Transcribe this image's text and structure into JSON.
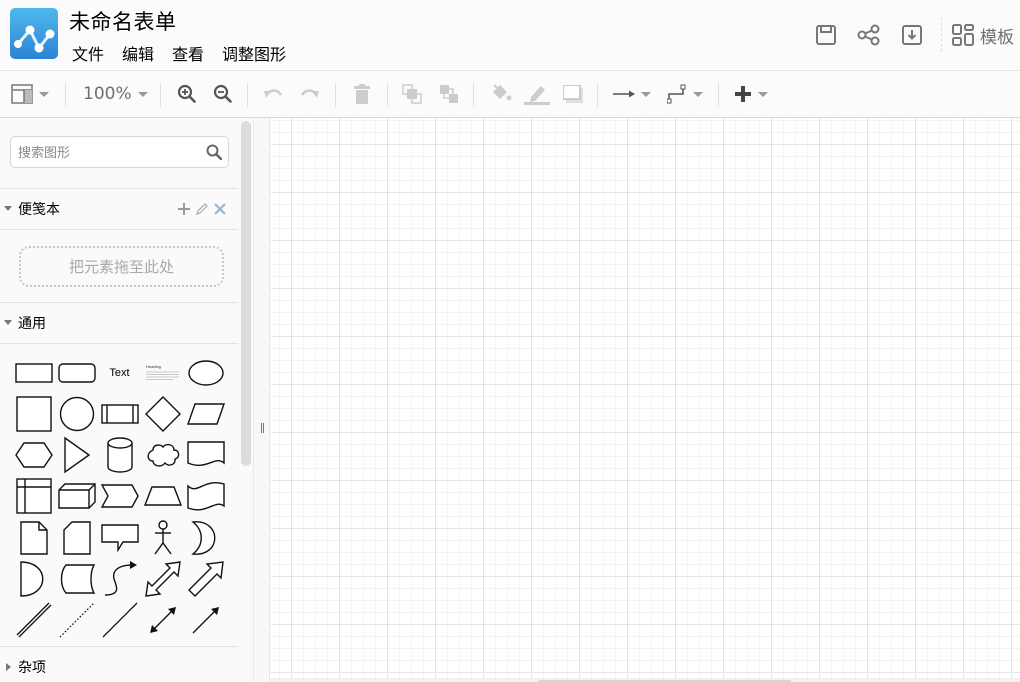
{
  "app": {
    "title": "未命名表单",
    "logo_icon": "diagram-graph-icon",
    "brand_color": "#3a9ce2"
  },
  "menu": [
    {
      "label": "文件"
    },
    {
      "label": "编辑"
    },
    {
      "label": "查看"
    },
    {
      "label": "调整图形"
    }
  ],
  "header_actions": {
    "save_icon": "save-icon",
    "share_icon": "share-icon",
    "download_icon": "download-icon",
    "templates_label": "模板",
    "templates_icon": "grid-icon"
  },
  "toolbar": {
    "zoom_level": "100%",
    "buttons": [
      {
        "name": "format-panel-toggle",
        "icon": "panel-layout-icon",
        "enabled": true
      },
      {
        "name": "zoom-in",
        "icon": "zoom-in-icon",
        "enabled": true
      },
      {
        "name": "zoom-out",
        "icon": "zoom-out-icon",
        "enabled": true
      },
      {
        "name": "undo",
        "icon": "undo-icon",
        "enabled": false
      },
      {
        "name": "redo",
        "icon": "redo-icon",
        "enabled": false
      },
      {
        "name": "delete",
        "icon": "trash-icon",
        "enabled": false
      },
      {
        "name": "to-front",
        "icon": "to-front-icon",
        "enabled": false
      },
      {
        "name": "to-back",
        "icon": "to-back-icon",
        "enabled": false
      },
      {
        "name": "fill-color",
        "icon": "paint-bucket-icon",
        "enabled": false
      },
      {
        "name": "line-color",
        "icon": "pencil-line-icon",
        "enabled": false
      },
      {
        "name": "shadow",
        "icon": "shadow-icon",
        "enabled": false
      },
      {
        "name": "connection",
        "icon": "arrow-right-icon",
        "enabled": true
      },
      {
        "name": "waypoints",
        "icon": "orthogonal-connector-icon",
        "enabled": true
      },
      {
        "name": "insert",
        "icon": "plus-icon",
        "enabled": true
      }
    ]
  },
  "sidebar": {
    "search_placeholder": "搜索图形",
    "scratchpad": {
      "title": "便笺本",
      "dropzone_text": "把元素拖至此处",
      "actions": [
        "add",
        "edit",
        "close"
      ]
    },
    "general": {
      "title": "通用",
      "text_shape_label": "Text",
      "heading_shape_label": "Heading",
      "shapes": [
        "rectangle",
        "rounded-rectangle",
        "text",
        "textbox",
        "ellipse",
        "square",
        "circle",
        "process",
        "diamond",
        "parallelogram",
        "hexagon",
        "triangle",
        "cylinder",
        "cloud",
        "document",
        "internal-storage",
        "cube",
        "step",
        "trapezoid",
        "tape",
        "note",
        "card",
        "callout",
        "actor",
        "or",
        "and",
        "data-storage",
        "curved-arrow",
        "bidirectional-arrow",
        "single-arrow",
        "link",
        "dashed-line",
        "line",
        "bidirectional-connector",
        "directional-connector"
      ]
    },
    "misc": {
      "title": "杂项"
    }
  }
}
